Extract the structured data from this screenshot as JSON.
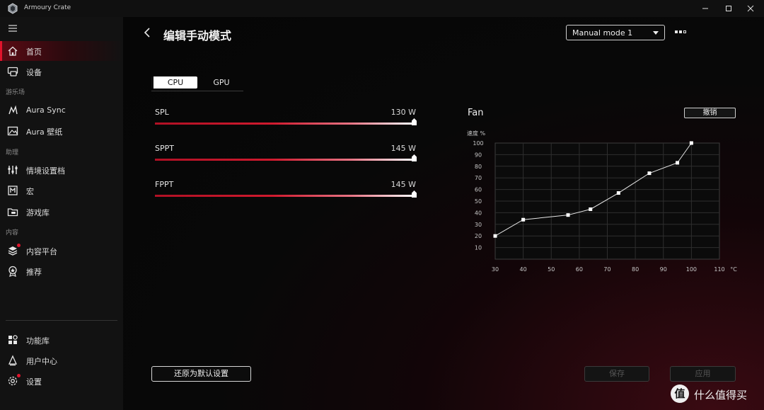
{
  "app": {
    "title": "Armoury Crate"
  },
  "sidebar": {
    "items": [
      {
        "label": "首页",
        "icon": "home-icon",
        "active": true
      },
      {
        "label": "设备",
        "icon": "device-icon"
      },
      {
        "label": "Aura Sync",
        "icon": "aura-sync-icon"
      },
      {
        "label": "Aura 壁纸",
        "icon": "wallpaper-icon"
      },
      {
        "label": "情境设置档",
        "icon": "scenario-profiles-icon"
      },
      {
        "label": "宏",
        "icon": "macro-icon"
      },
      {
        "label": "游戏库",
        "icon": "game-library-icon"
      },
      {
        "label": "内容平台",
        "icon": "content-platform-icon",
        "badge": true
      },
      {
        "label": "推荐",
        "icon": "featured-icon"
      },
      {
        "label": "功能库",
        "icon": "feature-library-icon"
      },
      {
        "label": "用户中心",
        "icon": "user-center-icon"
      },
      {
        "label": "设置",
        "icon": "settings-icon",
        "badge": true
      }
    ],
    "sections": [
      "游乐场",
      "助理",
      "内容"
    ]
  },
  "header": {
    "title": "编辑手动模式",
    "mode_select": "Manual mode 1"
  },
  "tabs": [
    "CPU",
    "GPU"
  ],
  "active_tab": "CPU",
  "sliders": [
    {
      "label": "SPL",
      "value": "130 W",
      "level": 1.0
    },
    {
      "label": "SPPT",
      "value": "145 W",
      "level": 1.0
    },
    {
      "label": "FPPT",
      "value": "145 W",
      "level": 1.0
    }
  ],
  "fan": {
    "title": "Fan",
    "undo_label": "撤销"
  },
  "chart_data": {
    "type": "line",
    "title": "",
    "ylabel": "速度 %",
    "xlabel": "°C",
    "x_ticks": [
      "30",
      "40",
      "50",
      "60",
      "70",
      "80",
      "90",
      "100",
      "110"
    ],
    "y_ticks": [
      "10",
      "20",
      "30",
      "40",
      "50",
      "60",
      "70",
      "80",
      "90",
      "100"
    ],
    "xlim": [
      30,
      110
    ],
    "ylim": [
      0,
      100
    ],
    "grid": true,
    "series": [
      {
        "x": [
          30,
          40,
          56,
          64,
          74,
          85,
          95,
          100
        ],
        "y": [
          20,
          34,
          38,
          43,
          57,
          74,
          83,
          100
        ]
      }
    ]
  },
  "buttons": {
    "reset": "还原为默认设置",
    "save": "保存",
    "apply": "应用"
  },
  "watermark": {
    "badge": "值",
    "text": "什么值得买"
  },
  "colors": {
    "accent": "#e0142c",
    "sidebar_bg": "#121212",
    "background": "#080808"
  }
}
